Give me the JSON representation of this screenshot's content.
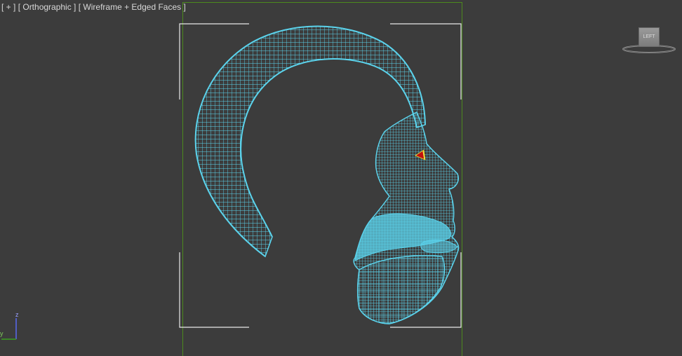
{
  "viewport": {
    "menu": {
      "plus_label": "[ + ]",
      "view_label": "[ Orthographic ]",
      "shading_label": "[ Wireframe + Edged Faces ]"
    }
  },
  "viewcube": {
    "face_label": "LEFT"
  },
  "axis_tripod": {
    "z_label": "z",
    "y_label": "y"
  },
  "colors": {
    "background": "#3c3c3c",
    "wireframe": "#5bd3ec",
    "render_frame": "#4c8a1e",
    "safe_frame": "#ffffff",
    "eye_marker": "#c01010"
  }
}
